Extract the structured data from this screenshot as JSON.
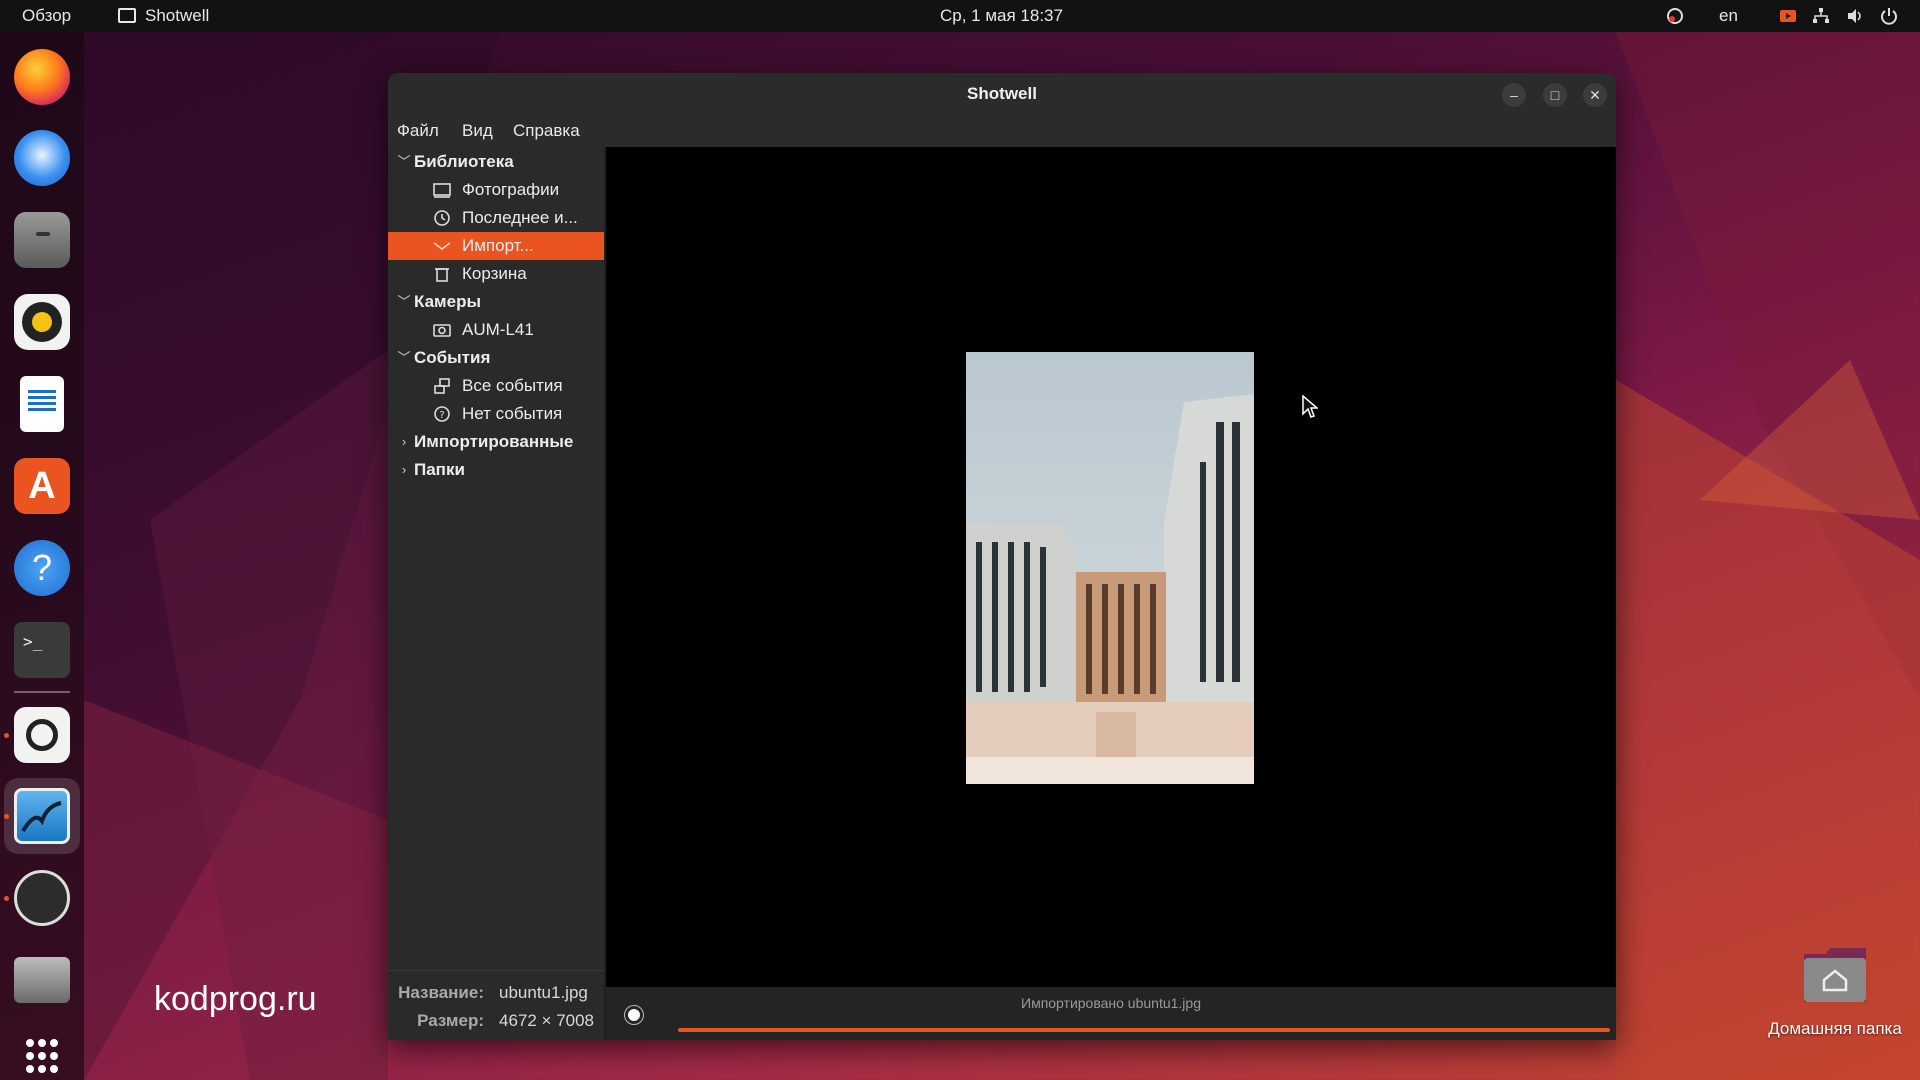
{
  "topbar": {
    "activities": "Обзор",
    "app_name": "Shotwell",
    "clock": "Ср, 1 мая  18:37",
    "lang": "en"
  },
  "dock": {
    "apps": [
      "firefox-icon",
      "thunderbird-icon",
      "files-icon",
      "rhythmbox-icon",
      "libreoffice-writer-icon",
      "app-center-icon",
      "help-icon",
      "terminal-icon",
      "screenshot-icon",
      "shotwell-icon",
      "obs-icon",
      "drive-icon",
      "show-apps-icon"
    ]
  },
  "window": {
    "title": "Shotwell",
    "menu": [
      "Файл",
      "Вид",
      "Справка"
    ]
  },
  "sidebar": {
    "library": "Библиотека",
    "photos": "Фотографии",
    "recent": "Последнее и...",
    "import": "Импорт...",
    "trash": "Корзина",
    "cameras": "Камеры",
    "camera_device": "AUM-L41",
    "events": "События",
    "all_events": "Все события",
    "no_event": "Нет события",
    "imported": "Импортированные",
    "folders": "Папки"
  },
  "meta": {
    "name_label": "Название:",
    "name_value": "ubuntu1.jpg",
    "size_label": "Размер:",
    "size_value": "4672 × 7008"
  },
  "status": {
    "text": "Импортировано ubuntu1.jpg",
    "progress": 1.0
  },
  "desktop": {
    "watermark": "kodprog.ru",
    "home_folder": "Домашняя папка"
  },
  "colors": {
    "accent": "#e95420",
    "topbar": "#121212",
    "window_bg": "#202020"
  }
}
